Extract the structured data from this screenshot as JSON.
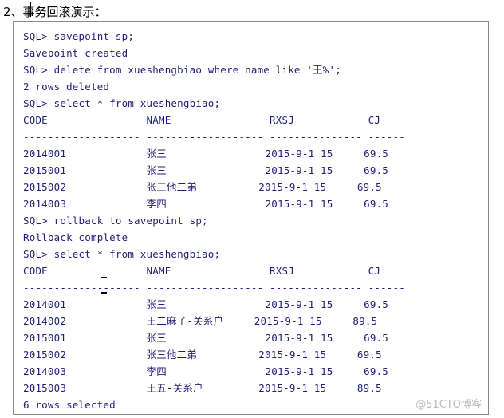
{
  "document": {
    "heading": "2、事务回滚演示：",
    "heading_number": "2、",
    "heading_title": "事务回滚演示：",
    "watermark": "@51CTO博客",
    "code_lines": [
      "SQL> savepoint sp;",
      "Savepoint created",
      "SQL> delete from xueshengbiao where name like '王%';",
      "2 rows deleted",
      "SQL> select * from xueshengbiao;",
      "CODE                NAME                RXSJ            CJ",
      "------------------- ------------------- --------------- ------",
      "2014001             张三                2015-9-1 15     69.5",
      "2015001             张三                2015-9-1 15     69.5",
      "2015002             张三他二弟          2015-9-1 15     69.5",
      "2014003             李四                2015-9-1 15     69.5",
      "SQL> rollback to savepoint sp;",
      "Rollback complete",
      "SQL> select * from xueshengbiao;",
      "CODE                NAME                RXSJ            CJ",
      "------------------- ------------------- --------------- ------",
      "2014001             张三                2015-9-1 15     69.5",
      "2014002             王二麻子-关系户     2015-9-1 15     89.5",
      "2015001             张三                2015-9-1 15     69.5",
      "2015002             张三他二弟          2015-9-1 15     69.5",
      "2014003             李四                2015-9-1 15     69.5",
      "2015003             王五-关系户         2015-9-1 15     89.5",
      "6 rows selected"
    ],
    "colors": {
      "code_text": "#1f1f7a",
      "heading_text": "#000000",
      "border": "#8a8a8a",
      "watermark": "#b9b9b9",
      "background": "#ffffff"
    }
  }
}
